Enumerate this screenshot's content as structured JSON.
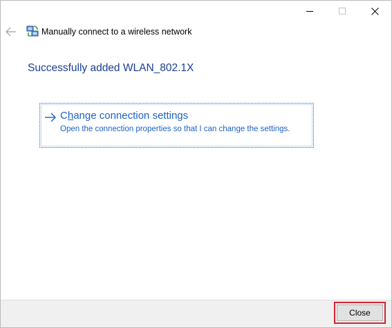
{
  "window": {
    "title": "Manually connect to a wireless network",
    "controls": {
      "minimize": "minimize-icon",
      "maximize": "maximize-icon",
      "close": "close-icon"
    }
  },
  "nav": {
    "back_icon": "back-arrow-icon"
  },
  "heading": "Successfully added WLAN_802.1X",
  "command_link": {
    "title_prefix": "C",
    "title_mnemonic": "h",
    "title_suffix": "ange connection settings",
    "description": "Open the connection properties so that I can change the settings.",
    "icon": "right-arrow-icon"
  },
  "footer": {
    "close_label": "Close"
  },
  "colors": {
    "heading": "#1a3f94",
    "link": "#1c61c4",
    "highlight": "#d3232f",
    "footer_bg": "#f0f0f0"
  }
}
